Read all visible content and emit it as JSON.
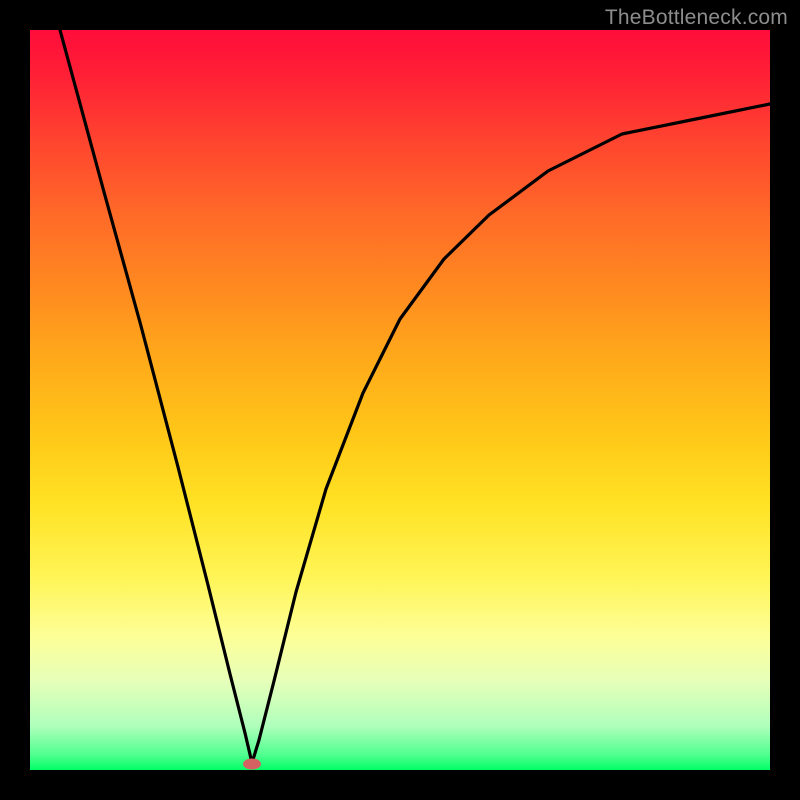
{
  "watermark": "TheBottleneck.com",
  "colors": {
    "frame": "#000000",
    "curve": "#000000",
    "dot": "#d46262",
    "watermark": "#8d8d8d"
  },
  "chart_data": {
    "type": "line",
    "title": "",
    "xlabel": "",
    "ylabel": "",
    "xlim": [
      0,
      100
    ],
    "ylim": [
      0,
      100
    ],
    "grid": false,
    "legend": false,
    "series": [
      {
        "name": "bottleneck-curve",
        "x": [
          4,
          10,
          15,
          20,
          24,
          27,
          29,
          30,
          31,
          33,
          36,
          40,
          45,
          50,
          56,
          62,
          70,
          80,
          90,
          100
        ],
        "y": [
          100,
          78,
          60,
          41,
          25,
          13,
          5,
          1,
          4,
          12,
          24,
          38,
          51,
          61,
          69,
          75,
          81,
          86,
          88,
          90
        ]
      }
    ],
    "annotations": [
      {
        "type": "point",
        "name": "minimum",
        "x": 30,
        "y": 0.5
      }
    ]
  }
}
